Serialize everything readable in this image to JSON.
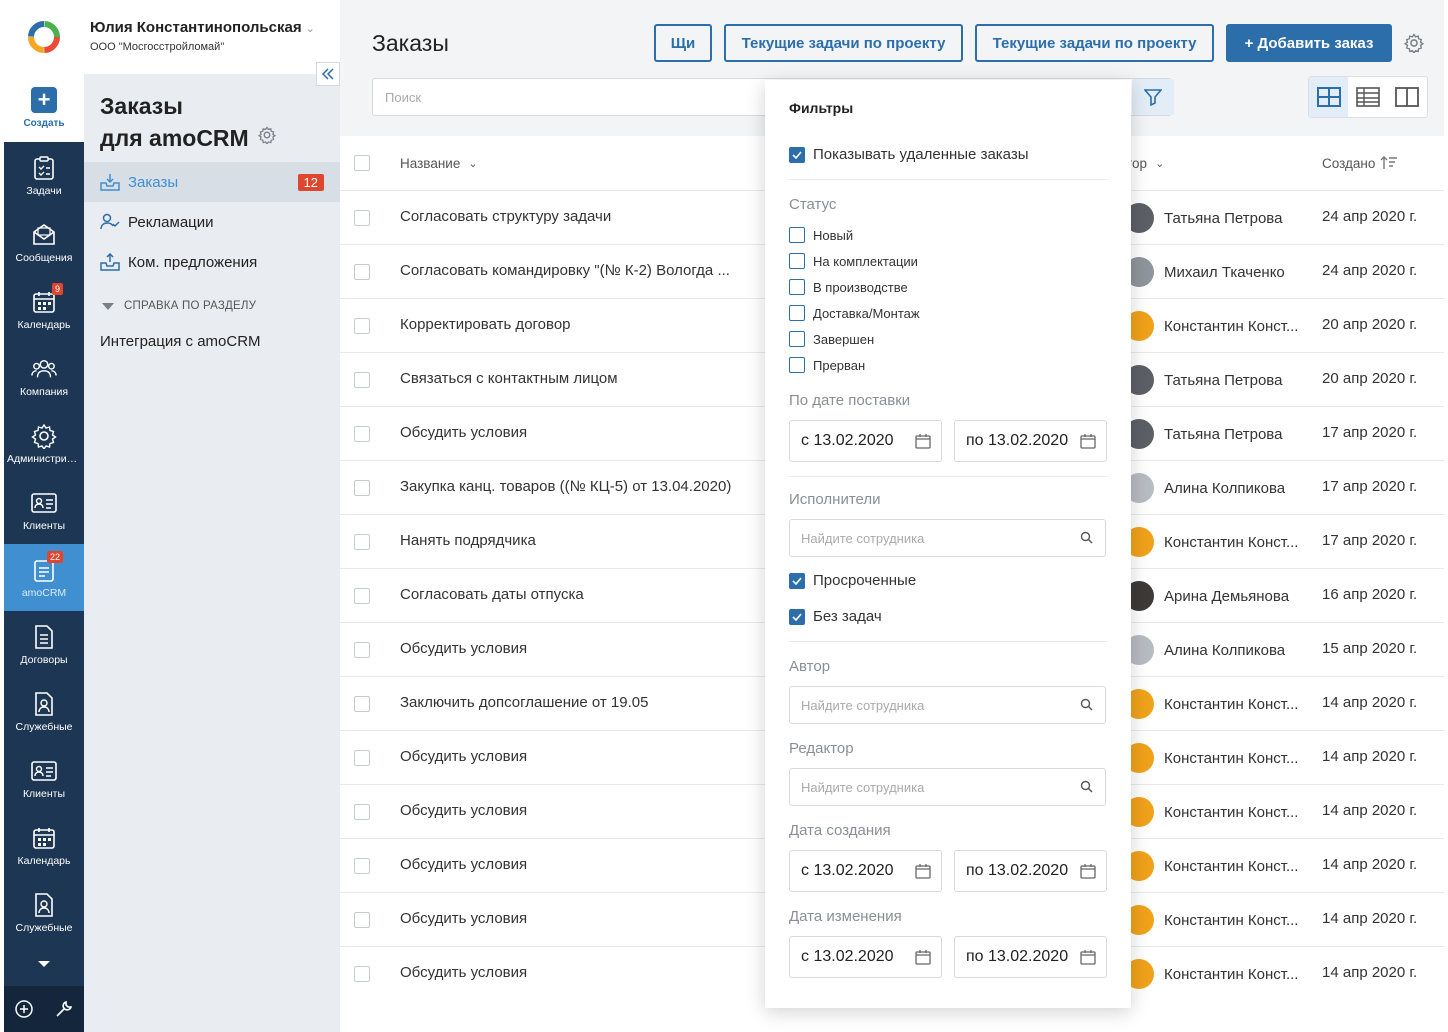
{
  "user": {
    "name": "Юлия Константинопольская",
    "org": "ООО \"Мосгосстройломай\""
  },
  "leftnav": {
    "create_label": "Создать",
    "items": [
      {
        "label": "Задачи",
        "icon": "tasks-icon"
      },
      {
        "label": "Сообщения",
        "icon": "messages-icon"
      },
      {
        "label": "Календарь",
        "icon": "calendar-icon",
        "badge": "9"
      },
      {
        "label": "Компания",
        "icon": "company-icon"
      },
      {
        "label": "Администрирование",
        "icon": "admin-gear-icon"
      },
      {
        "label": "Клиенты",
        "icon": "clients-icon"
      },
      {
        "label": "amoCRM",
        "icon": "amocrm-icon",
        "badge": "22"
      },
      {
        "label": "Договоры",
        "icon": "contracts-icon"
      },
      {
        "label": "Служебные",
        "icon": "service-icon"
      },
      {
        "label": "Клиенты",
        "icon": "clients-icon"
      },
      {
        "label": "Календарь",
        "icon": "calendar-icon"
      },
      {
        "label": "Служебные",
        "icon": "service-icon"
      }
    ]
  },
  "subnav": {
    "title_line1": "Заказы",
    "title_line2": "для amoCRM",
    "items": [
      {
        "label": "Заказы",
        "count": "12"
      },
      {
        "label": "Рекламации"
      },
      {
        "label": "Ком. предложения"
      }
    ],
    "help_header": "СПРАВКА ПО РАЗДЕЛУ",
    "help_link": "Интеграция с amoCRM"
  },
  "header": {
    "title": "Заказы",
    "btn_short": "Щи",
    "btn_tasks1": "Текущие задачи по проекту",
    "btn_tasks2": "Текущие задачи по проекту",
    "btn_add": "+ Добавить заказ",
    "search_placeholder": "Поиск"
  },
  "table": {
    "col_name": "Название",
    "col_author": "тор",
    "col_created": "Создано",
    "rows": [
      {
        "name": "Согласовать структуру задачи",
        "author": "Татьяна Петрова",
        "date": "24 апр 2020 г.",
        "avatar": "#5c5f66"
      },
      {
        "name": "Согласовать командировку \"(№ К-2) Вологда ...",
        "author": "Михаил Ткаченко",
        "date": "24 апр 2020 г.",
        "avatar": "#8f959c"
      },
      {
        "name": "Корректировать договор",
        "author": "Константин Конст...",
        "date": "20 апр 2020 г.",
        "avatar": "#f0a21b"
      },
      {
        "name": "Связаться с контактным лицом",
        "author": "Татьяна Петрова",
        "date": "20 апр 2020 г.",
        "avatar": "#5c5f66"
      },
      {
        "name": "Обсудить условия",
        "author": "Татьяна Петрова",
        "date": "17 апр 2020 г.",
        "avatar": "#5c5f66"
      },
      {
        "name": "Закупка канц. товаров ((№ КЦ-5) от 13.04.2020)",
        "author": "Алина Колпикова",
        "date": "17 апр 2020 г.",
        "avatar": "#b7bcc2"
      },
      {
        "name": "Нанять подрядчика",
        "author": "Константин Конст...",
        "date": "17 апр 2020 г.",
        "avatar": "#f0a21b"
      },
      {
        "name": "Согласовать даты отпуска",
        "author": "Арина Демьянова",
        "date": "16 апр 2020 г.",
        "avatar": "#3e3a38"
      },
      {
        "name": "Обсудить условия",
        "author": "Алина Колпикова",
        "date": "15 апр 2020 г.",
        "avatar": "#b7bcc2"
      },
      {
        "name": "Заключить допсоглашение от 19.05",
        "author": "Константин Конст...",
        "date": "14 апр 2020 г.",
        "avatar": "#f0a21b"
      },
      {
        "name": "Обсудить условия",
        "author": "Константин Конст...",
        "date": "14 апр 2020 г.",
        "avatar": "#f0a21b"
      },
      {
        "name": "Обсудить условия",
        "author": "Константин Конст...",
        "date": "14 апр 2020 г.",
        "avatar": "#f0a21b"
      },
      {
        "name": "Обсудить условия",
        "author": "Константин Конст...",
        "date": "14 апр 2020 г.",
        "avatar": "#f0a21b"
      },
      {
        "name": "Обсудить условия",
        "author": "Константин Конст...",
        "date": "14 апр 2020 г.",
        "avatar": "#f0a21b"
      },
      {
        "name": "Обсудить условия",
        "author": "Константин Конст...",
        "date": "14 апр 2020 г.",
        "avatar": "#f0a21b"
      }
    ]
  },
  "filters": {
    "title": "Фильтры",
    "show_deleted": "Показывать удаленные заказы",
    "status_label": "Статус",
    "statuses": [
      "Новый",
      "На комплектации",
      "В производстве",
      "Доставка/Монтаж",
      "Завершен",
      "Прерван"
    ],
    "delivery_label": "По дате поставки",
    "date_from": "с 13.02.2020",
    "date_to": "по 13.02.2020",
    "executors_label": "Исполнители",
    "employee_placeholder": "Найдите сотрудника",
    "overdue": "Просроченные",
    "no_tasks": "Без задач",
    "author_label": "Автор",
    "editor_label": "Редактор",
    "created_label": "Дата создания",
    "modified_label": "Дата изменения"
  },
  "colors": {
    "accent": "#2b6ea9",
    "nav_bg": "#1d3653",
    "nav_active": "#3f8fd1",
    "badge": "#e0452d"
  }
}
